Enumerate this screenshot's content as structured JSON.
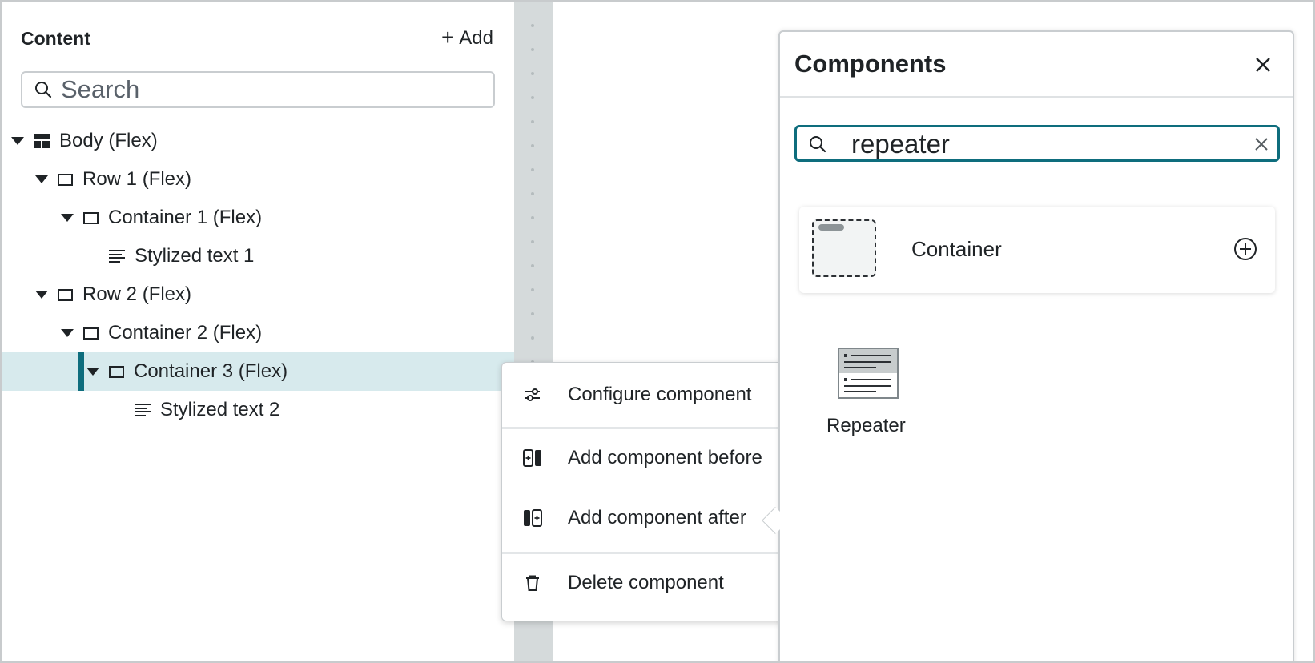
{
  "content_panel": {
    "title": "Content",
    "add_label": "Add",
    "search_placeholder": "Search",
    "tree": [
      {
        "label": "Body (Flex)",
        "icon": "layout-icon",
        "expanded": true,
        "level": 0
      },
      {
        "label": "Row 1 (Flex)",
        "icon": "box-icon",
        "expanded": true,
        "level": 1
      },
      {
        "label": "Container 1 (Flex)",
        "icon": "box-icon",
        "expanded": true,
        "level": 2
      },
      {
        "label": "Stylized text 1",
        "icon": "text-lines-icon",
        "level": 3
      },
      {
        "label": "Row 2 (Flex)",
        "icon": "box-icon",
        "expanded": true,
        "level": 1
      },
      {
        "label": "Container 2 (Flex)",
        "icon": "box-icon",
        "expanded": true,
        "level": 2
      },
      {
        "label": "Container 3 (Flex)",
        "icon": "box-icon",
        "expanded": true,
        "level": 3,
        "selected": true
      },
      {
        "label": "Stylized text 2",
        "icon": "text-lines-icon",
        "level": 4
      }
    ]
  },
  "context_menu": {
    "items": [
      {
        "label": "Configure component",
        "icon": "sliders-icon"
      },
      {
        "label": "Add component before",
        "icon": "insert-before-icon"
      },
      {
        "label": "Add component after",
        "icon": "insert-after-icon"
      },
      {
        "label": "Delete component",
        "icon": "trash-icon"
      }
    ]
  },
  "components_panel": {
    "title": "Components",
    "search_value": "repeater",
    "results": [
      {
        "label": "Container",
        "icon": "container-thumbnail"
      },
      {
        "label": "Repeater",
        "icon": "repeater-thumbnail"
      }
    ]
  },
  "colors": {
    "accent": "#0e6d7d",
    "selected_row_bg": "#d7eaed",
    "divider_strip": "#d5dadb",
    "text": "#1f2326"
  }
}
